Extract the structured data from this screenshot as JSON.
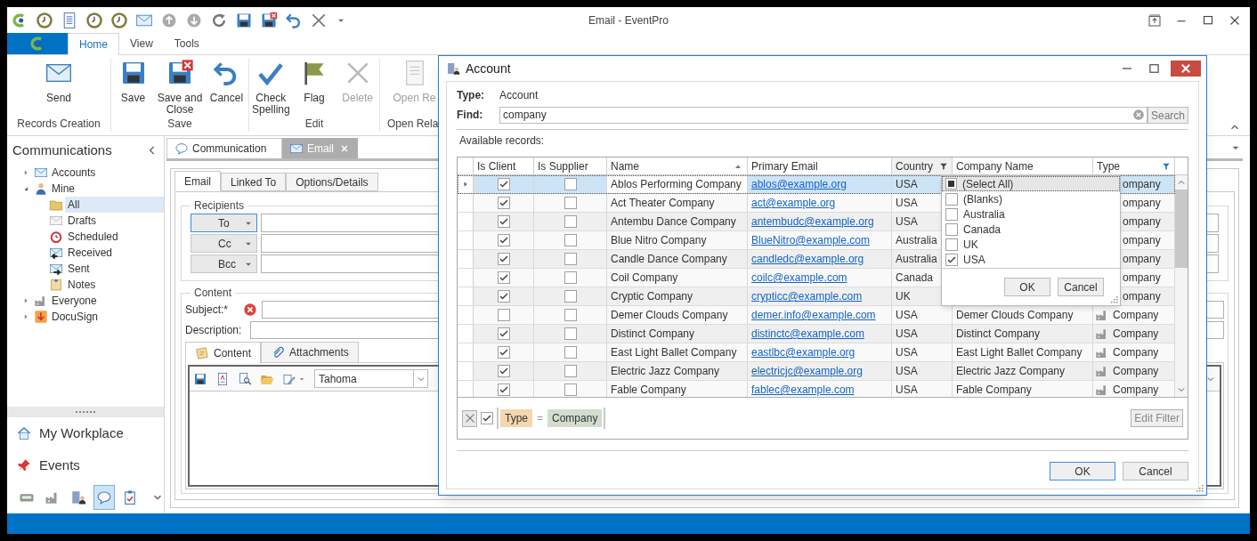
{
  "window": {
    "title": "Email - EventPro"
  },
  "ribbon_tabs": [
    {
      "label": "Home",
      "selected": true
    },
    {
      "label": "View",
      "selected": false
    },
    {
      "label": "Tools",
      "selected": false
    }
  ],
  "ribbon_groups": [
    {
      "label": "Records Creation",
      "buttons": [
        {
          "label": "Send",
          "disabled": false
        }
      ]
    },
    {
      "label": "Save",
      "buttons": [
        {
          "label": "Save",
          "disabled": false
        },
        {
          "label": "Save and Close",
          "disabled": false
        },
        {
          "label": "Cancel",
          "disabled": false
        }
      ]
    },
    {
      "label": "Edit",
      "buttons": [
        {
          "label": "Check Spelling",
          "disabled": false
        },
        {
          "label": "Flag",
          "disabled": false
        },
        {
          "label": "Delete",
          "disabled": true
        }
      ]
    },
    {
      "label": "Open Rela",
      "buttons": [
        {
          "label": "Open Re",
          "disabled": true
        }
      ]
    }
  ],
  "navigation": {
    "title": "Communications",
    "tree": [
      {
        "label": "Accounts",
        "expanded": false,
        "selected": false
      },
      {
        "label": "Mine",
        "expanded": true,
        "selected": false,
        "children": [
          {
            "label": "All",
            "selected": true
          },
          {
            "label": "Drafts",
            "selected": false
          },
          {
            "label": "Scheduled",
            "selected": false
          },
          {
            "label": "Received",
            "selected": false
          },
          {
            "label": "Sent",
            "selected": false
          },
          {
            "label": "Notes",
            "selected": false
          }
        ]
      },
      {
        "label": "Everyone",
        "expanded": false,
        "selected": false
      },
      {
        "label": "DocuSign",
        "expanded": false,
        "selected": false
      }
    ],
    "sections": [
      {
        "label": "My Workplace"
      },
      {
        "label": "Events"
      }
    ],
    "shortcuts": [
      {
        "selected": false
      },
      {
        "selected": false
      },
      {
        "selected": false
      },
      {
        "selected": true
      },
      {
        "selected": false
      }
    ]
  },
  "document_tabs": [
    {
      "label": "Communication",
      "selected": false
    },
    {
      "label": "Email",
      "selected": true
    }
  ],
  "form_tabs": [
    {
      "label": "Email",
      "selected": true
    },
    {
      "label": "Linked To",
      "selected": false
    },
    {
      "label": "Options/Details",
      "selected": false
    }
  ],
  "recipients": {
    "title": "Recipients",
    "buttons": [
      {
        "label": "To",
        "focused": true
      },
      {
        "label": "Cc",
        "focused": false
      },
      {
        "label": "Bcc",
        "focused": false
      }
    ]
  },
  "content": {
    "title": "Content",
    "subject_label": "Subject:*",
    "subject_error": true,
    "description_label": "Description:",
    "tabs": [
      {
        "label": "Content",
        "selected": true
      },
      {
        "label": "Attachments",
        "selected": false
      }
    ],
    "font": "Tahoma"
  },
  "dialog": {
    "title": "Account",
    "type_label": "Type:",
    "type_value": "Account",
    "find_label": "Find:",
    "find_value": "company",
    "search_button": "Search",
    "records_label": "Available records:",
    "columns": [
      {
        "label": "Is Client",
        "sorted": false,
        "filtered": false,
        "menu_open": false
      },
      {
        "label": "Is Supplier",
        "sorted": false,
        "filtered": false,
        "menu_open": false
      },
      {
        "label": "Name",
        "sorted": true,
        "filtered": false,
        "menu_open": false
      },
      {
        "label": "Primary Email",
        "sorted": false,
        "filtered": false,
        "menu_open": false
      },
      {
        "label": "Country",
        "sorted": false,
        "filtered": false,
        "menu_open": true
      },
      {
        "label": "Company Name",
        "sorted": false,
        "filtered": false,
        "menu_open": false
      },
      {
        "label": "Type",
        "sorted": false,
        "filtered": true,
        "menu_open": false
      }
    ],
    "rows": [
      {
        "selected": true,
        "is_client": true,
        "is_supplier": false,
        "name": "Ablos Performing Company",
        "email": "ablos@example.org",
        "country": "USA",
        "type": "ompany"
      },
      {
        "selected": false,
        "is_client": true,
        "is_supplier": false,
        "name": "Act Theater Company",
        "email": "act@example.org",
        "country": "USA",
        "type": "ompany"
      },
      {
        "selected": false,
        "is_client": true,
        "is_supplier": false,
        "name": "Antembu Dance Company",
        "email": "antembudc@example.org",
        "country": "USA",
        "type": "ompany"
      },
      {
        "selected": false,
        "is_client": true,
        "is_supplier": false,
        "name": "Blue Nitro Company",
        "email": "BlueNitro@example.com",
        "country": "Australia",
        "type": "ompany"
      },
      {
        "selected": false,
        "is_client": true,
        "is_supplier": false,
        "name": "Candle Dance Company",
        "email": "candledc@example.org",
        "country": "Australia",
        "type": "ompany"
      },
      {
        "selected": false,
        "is_client": true,
        "is_supplier": false,
        "name": "Coil Company",
        "email": "coilc@example.com",
        "country": "Canada",
        "type": "ompany"
      },
      {
        "selected": false,
        "is_client": true,
        "is_supplier": false,
        "name": "Cryptic Company",
        "email": "crypticc@example.com",
        "country": "UK",
        "type": "ompany"
      },
      {
        "selected": false,
        "is_client": false,
        "is_supplier": false,
        "name": "Demer Clouds Company",
        "email": "demer.info@example.com",
        "country": "USA",
        "company_name": "Demer Clouds Company",
        "type": "Company"
      },
      {
        "selected": false,
        "is_client": true,
        "is_supplier": false,
        "name": "Distinct Company",
        "email": "distinctc@example.com",
        "country": "USA",
        "company_name": "Distinct Company",
        "type": "Company"
      },
      {
        "selected": false,
        "is_client": true,
        "is_supplier": false,
        "name": "East Light Ballet Company",
        "email": "eastlbc@example.org",
        "country": "USA",
        "company_name": "East Light Ballet Company",
        "type": "Company"
      },
      {
        "selected": false,
        "is_client": true,
        "is_supplier": false,
        "name": "Electric Jazz Company",
        "email": "electricjc@example.org",
        "country": "USA",
        "company_name": "Electric Jazz Company",
        "type": "Company"
      },
      {
        "selected": false,
        "is_client": true,
        "is_supplier": false,
        "name": "Fable Company",
        "email": "fablec@example.com",
        "country": "USA",
        "company_name": "Fable Company",
        "type": "Company"
      }
    ],
    "filter": {
      "enabled": true,
      "field": "Type",
      "operator": "=",
      "value": "Company",
      "edit_button": "Edit Filter"
    },
    "buttons": [
      {
        "label": "OK",
        "default": true
      },
      {
        "label": "Cancel",
        "default": false
      }
    ],
    "filter_popup": {
      "select_all": {
        "label": "(Select All)",
        "indeterminate": true,
        "selected": true
      },
      "items": [
        {
          "label": "(Blanks)",
          "checked": false
        },
        {
          "label": "Australia",
          "checked": false
        },
        {
          "label": "Canada",
          "checked": false
        },
        {
          "label": "UK",
          "checked": false
        },
        {
          "label": "USA",
          "checked": true
        }
      ],
      "buttons": [
        "OK",
        "Cancel"
      ]
    }
  }
}
